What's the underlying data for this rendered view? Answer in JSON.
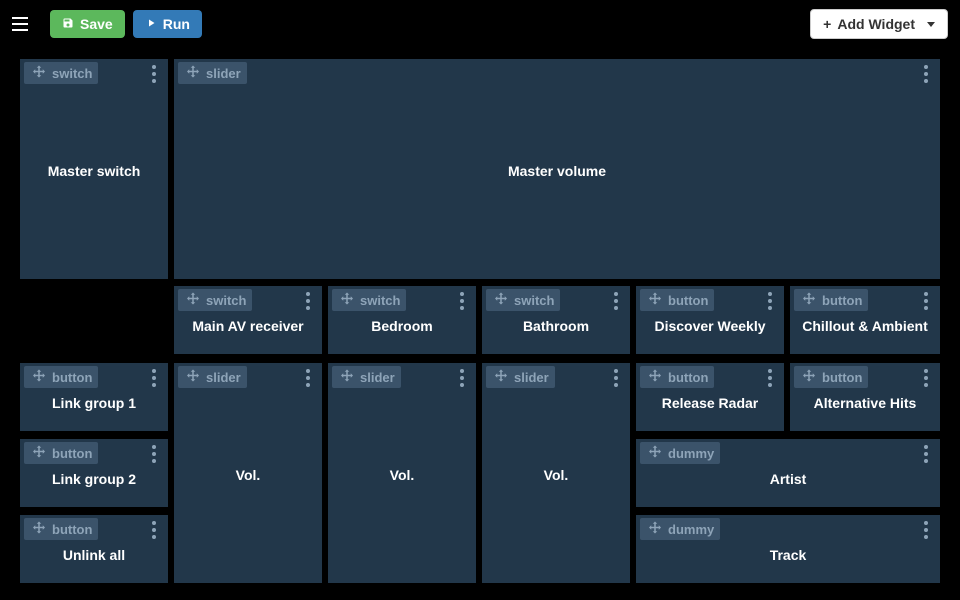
{
  "toolbar": {
    "save_label": "Save",
    "run_label": "Run",
    "add_widget_label": "Add Widget"
  },
  "widgets": {
    "master_switch": {
      "type": "switch",
      "title": "Master switch"
    },
    "master_volume": {
      "type": "slider",
      "title": "Master volume"
    },
    "main_av": {
      "type": "switch",
      "title": "Main AV receiver"
    },
    "bedroom": {
      "type": "switch",
      "title": "Bedroom"
    },
    "bathroom": {
      "type": "switch",
      "title": "Bathroom"
    },
    "discover_weekly": {
      "type": "button",
      "title": "Discover Weekly"
    },
    "chillout": {
      "type": "button",
      "title": "Chillout & Ambient"
    },
    "link1": {
      "type": "button",
      "title": "Link group 1"
    },
    "link2": {
      "type": "button",
      "title": "Link group 2"
    },
    "unlink": {
      "type": "button",
      "title": "Unlink all"
    },
    "vol1": {
      "type": "slider",
      "title": "Vol."
    },
    "vol2": {
      "type": "slider",
      "title": "Vol."
    },
    "vol3": {
      "type": "slider",
      "title": "Vol."
    },
    "release_radar": {
      "type": "button",
      "title": "Release Radar"
    },
    "alt_hits": {
      "type": "button",
      "title": "Alternative Hits"
    },
    "artist": {
      "type": "dummy",
      "title": "Artist"
    },
    "track": {
      "type": "dummy",
      "title": "Track"
    }
  }
}
